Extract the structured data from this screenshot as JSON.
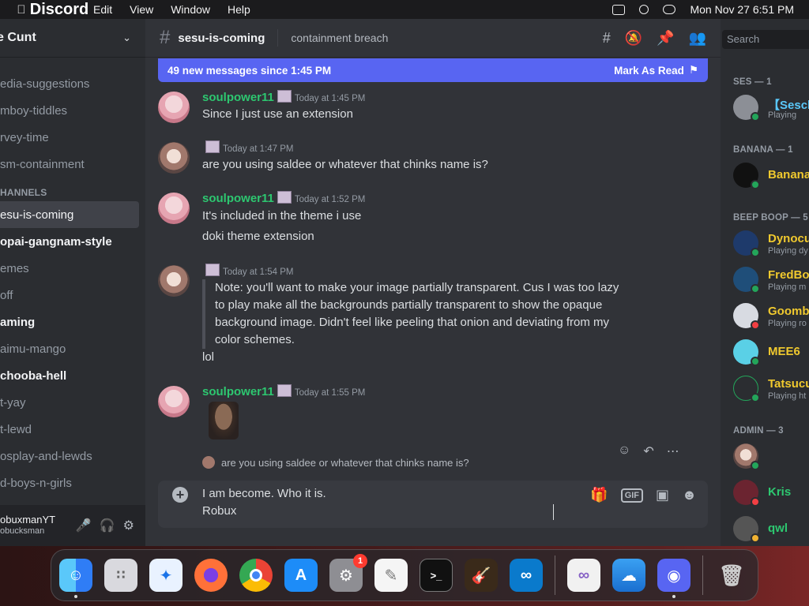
{
  "menubar": {
    "app": "Discord",
    "items": [
      "Edit",
      "View",
      "Window",
      "Help"
    ],
    "datetime": "Mon Nov 27  6:51 PM"
  },
  "server": {
    "name": "e Cunt",
    "channels_top": [
      "edia-suggestions",
      "mboy-tiddles",
      "rvey-time",
      "sm-containment"
    ],
    "category": "HANNELS",
    "channels": [
      {
        "name": "esu-is-coming",
        "state": "active"
      },
      {
        "name": "opai-gangnam-style",
        "state": "unread"
      },
      {
        "name": "emes",
        "state": "read"
      },
      {
        "name": "off",
        "state": "read"
      },
      {
        "name": "aming",
        "state": "unread"
      },
      {
        "name": "aimu-mango",
        "state": "read"
      },
      {
        "name": "chooba-hell",
        "state": "unread"
      },
      {
        "name": "t-yay",
        "state": "read"
      },
      {
        "name": "t-lewd",
        "state": "read"
      },
      {
        "name": "osplay-and-lewds",
        "state": "read"
      },
      {
        "name": "d-boys-n-girls",
        "state": "read"
      }
    ]
  },
  "user_panel": {
    "name": "obuxmanYT",
    "status": "obucksman"
  },
  "chat": {
    "channel": "sesu-is-coming",
    "topic": "containment breach",
    "banner": {
      "text": "49 new messages since 1:45 PM",
      "action": "Mark As Read"
    },
    "messages": [
      {
        "author": "soulpower11",
        "time": "Today at 1:45 PM",
        "lines": [
          "Since I just use an extension"
        ]
      },
      {
        "author": "",
        "time": "Today at 1:47 PM",
        "lines": [
          "are you using saldee or whatever that chinks name is?"
        ]
      },
      {
        "author": "soulpower11",
        "time": "Today at 1:52 PM",
        "lines": [
          "It's included in the theme i use",
          "doki theme extension"
        ]
      },
      {
        "author": "",
        "time": "Today at 1:54 PM",
        "quote": "Note: you'll want to make your image partially transparent. Cus I was too lazy to play make all the backgrounds partially transparent to show the opaque background image. Didn't feel like peeling that onion and deviating from my color schemes.",
        "lines": [
          "lol"
        ]
      },
      {
        "author": "soulpower11",
        "time": "Today at 1:55 PM",
        "lines": []
      }
    ],
    "reply_preview": "are you using saldee or whatever that chinks name is?",
    "composer": {
      "line1": "I am become. Who it is.",
      "line2": "Robux"
    }
  },
  "members": {
    "search_placeholder": "Search",
    "groups": [
      {
        "label": "SES — 1",
        "members": [
          {
            "name": "【Sesch",
            "activity": "Playing",
            "color": "#5ac8fa",
            "status": "online"
          }
        ]
      },
      {
        "label": "BANANA — 1",
        "members": [
          {
            "name": "Banana",
            "activity": "",
            "color": "#f0c92e",
            "status": "online"
          }
        ]
      },
      {
        "label": "BEEP BOOP — 5",
        "members": [
          {
            "name": "Dynocu",
            "activity": "Playing dy",
            "color": "#f0c92e",
            "status": "online"
          },
          {
            "name": "FredBo",
            "activity": "Playing m",
            "color": "#f0c92e",
            "status": "online"
          },
          {
            "name": "Goomb",
            "activity": "Playing ro",
            "color": "#f0c92e",
            "status": "dnd"
          },
          {
            "name": "MEE6",
            "activity": "",
            "color": "#f0c92e",
            "status": "online"
          },
          {
            "name": "Tatsucu",
            "activity": "Playing ht",
            "color": "#f0c92e",
            "status": "online"
          }
        ]
      },
      {
        "label": "ADMIN — 3",
        "members": [
          {
            "name": "",
            "activity": "",
            "color": "#7d3aa0",
            "status": "online"
          },
          {
            "name": "Kris",
            "activity": "",
            "color": "#2dc770",
            "status": "dnd"
          },
          {
            "name": "qwl",
            "activity": "",
            "color": "#2dc770",
            "status": "idle"
          }
        ]
      }
    ]
  },
  "dock": {
    "apps": [
      "finder-icon",
      "launchpad-icon",
      "safari-icon",
      "firefox-icon",
      "chrome-icon",
      "app-store-icon",
      "system-settings-icon",
      "textedit-icon",
      "terminal-icon",
      "garageband-icon",
      "vscode-icon",
      "visual-studio-icon",
      "weather-icon",
      "discord-icon",
      "trash-icon"
    ],
    "settings_badge": "1",
    "terminal_glyph": ">_",
    "gif_label": "GIF"
  }
}
